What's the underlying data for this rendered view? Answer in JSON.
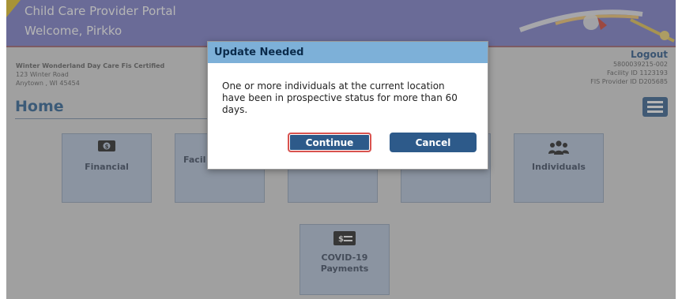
{
  "app": {
    "title": "Child Care Provider Portal",
    "welcome": "Welcome, Pirkko"
  },
  "org": {
    "name": "Winter Wonderland Day Care Fis Certified",
    "address1": "123 Winter Road",
    "address2": "Anytown , WI 45454"
  },
  "account": {
    "logout": "Logout",
    "id_line1": "5800039215-002",
    "facility_id": "Facility ID 1123193",
    "fis_provider_id": "FIS Provider ID D205685"
  },
  "page": {
    "title": "Home"
  },
  "tiles": [
    {
      "label": "Financial",
      "icon": "dollar-bill-icon"
    },
    {
      "label": "Facil",
      "icon": ""
    },
    {
      "label": "",
      "icon": ""
    },
    {
      "label": "",
      "icon": ""
    },
    {
      "label": "Individuals",
      "icon": "people-icon"
    },
    {
      "label": "COVID-19",
      "label2": "Payments",
      "icon": "payment-icon"
    }
  ],
  "dialog": {
    "title": "Update Needed",
    "message": "One or more individuals at the current location have been in prospective status for more than 60 days.",
    "continue_label": "Continue",
    "cancel_label": "Cancel"
  },
  "colors": {
    "header": "#7778c9",
    "primary": "#2d5a8a",
    "tile": "#b3c3db",
    "dialog_header": "#7db0d8",
    "highlight": "#d9534f"
  }
}
